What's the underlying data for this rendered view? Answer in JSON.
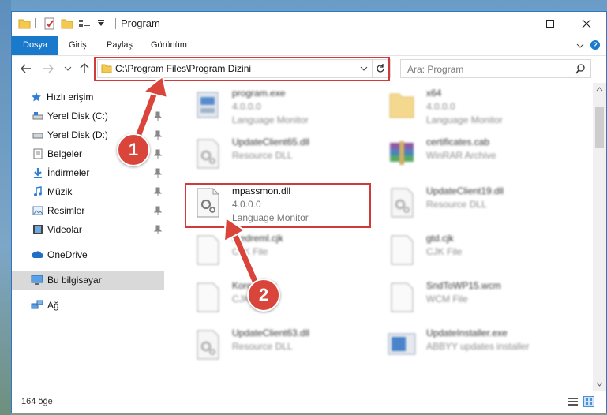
{
  "window": {
    "title": "Program"
  },
  "ribbon": {
    "tabs": [
      "Dosya",
      "Giriş",
      "Paylaş",
      "Görünüm"
    ],
    "help": "?"
  },
  "address": {
    "path": "C:\\Program Files\\Program Dizini"
  },
  "search": {
    "placeholder": "Ara: Program"
  },
  "sidebar": {
    "items": [
      {
        "label": "Hızlı erişim",
        "icon": "star-icon"
      },
      {
        "label": "Yerel Disk (C:)",
        "icon": "drive-icon"
      },
      {
        "label": "Yerel Disk (D:)",
        "icon": "drive-icon"
      },
      {
        "label": "Belgeler",
        "icon": "documents-icon"
      },
      {
        "label": "İndirmeler",
        "icon": "download-icon"
      },
      {
        "label": "Müzik",
        "icon": "music-icon"
      },
      {
        "label": "Resimler",
        "icon": "pictures-icon"
      },
      {
        "label": "Videolar",
        "icon": "videos-icon"
      },
      {
        "label": "OneDrive",
        "icon": "cloud-icon"
      },
      {
        "label": "Bu bilgisayar",
        "icon": "computer-icon"
      },
      {
        "label": "Ağ",
        "icon": "network-icon"
      }
    ]
  },
  "files": [
    {
      "name": "program.exe",
      "line2": "4.0.0.0",
      "line3": "Language Monitor"
    },
    {
      "name": "x64",
      "line2": "4.0.0.0",
      "line3": "Language Monitor"
    },
    {
      "name": "UpdateClient65.dll",
      "line2": "Resource DLL",
      "line3": ""
    },
    {
      "name": "certificates.cab",
      "line2": "WinRAR Archive",
      "line3": ""
    },
    {
      "name": "mpassmon.dll",
      "line2": "4.0.0.0",
      "line3": "Language Monitor"
    },
    {
      "name": "UpdateClient19.dll",
      "line2": "Resource DLL",
      "line3": ""
    },
    {
      "name": "feedreml.cjk",
      "line2": "CJK File",
      "line3": ""
    },
    {
      "name": "gtd.cjk",
      "line2": "CJK File",
      "line3": ""
    },
    {
      "name": "Korean.cjk",
      "line2": "CJK File",
      "line3": ""
    },
    {
      "name": "SndToWP15.wcm",
      "line2": "WCM File",
      "line3": ""
    },
    {
      "name": "UpdateClient63.dll",
      "line2": "Resource DLL",
      "line3": ""
    },
    {
      "name": "UpdateInstaller.exe",
      "line2": "ABBYY updates installer",
      "line3": ""
    }
  ],
  "status": {
    "count": "164 öğe"
  },
  "annotations": {
    "badge1": "1",
    "badge2": "2"
  },
  "colors": {
    "accent": "#1979ca",
    "highlight": "#d23a3a",
    "badge": "#d9443b"
  }
}
